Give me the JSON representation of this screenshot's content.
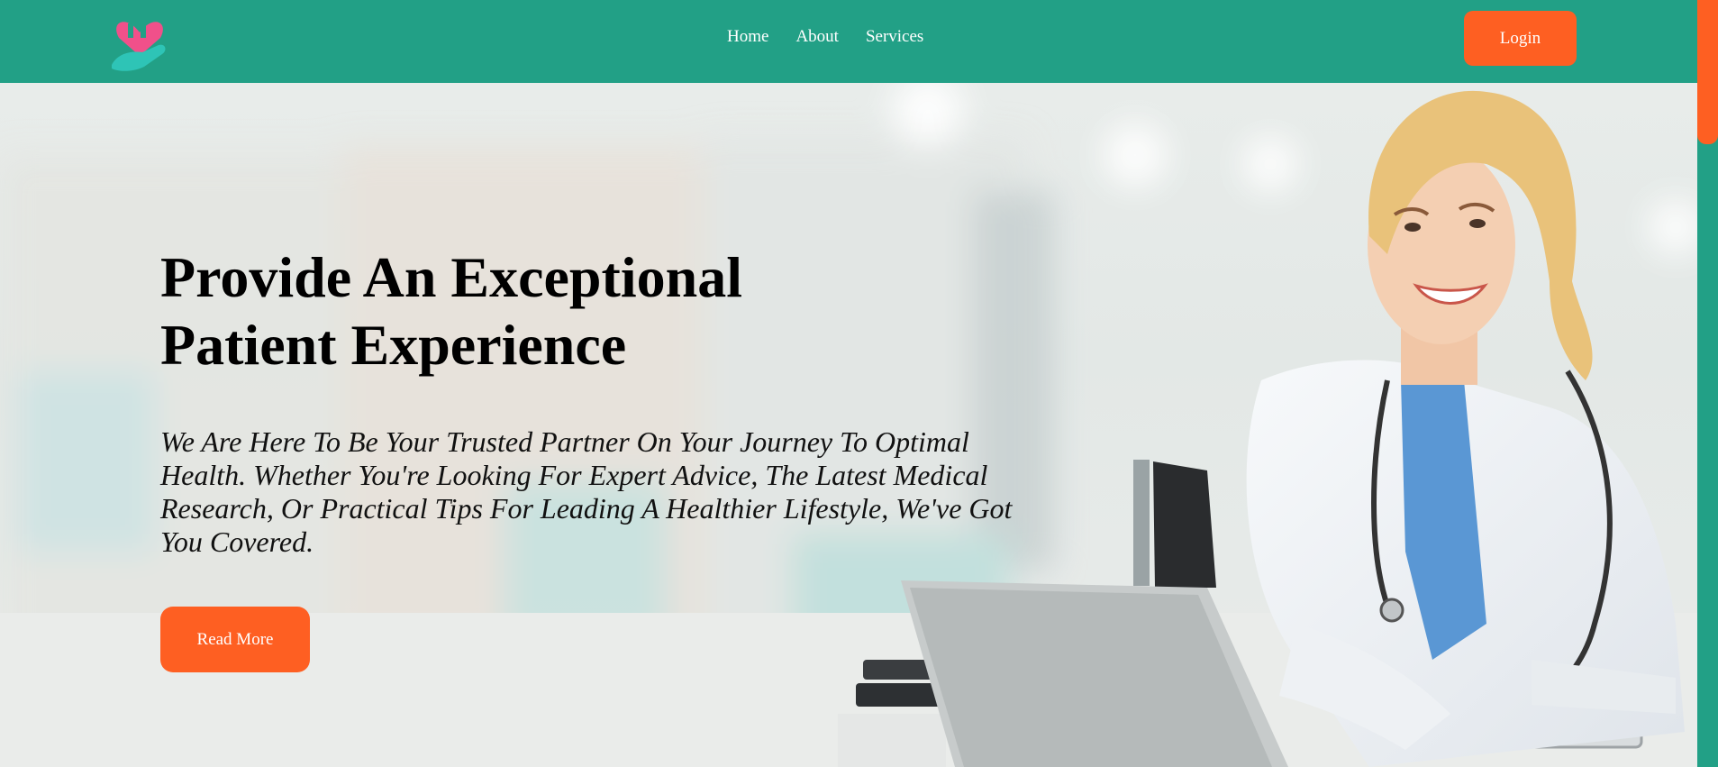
{
  "navbar": {
    "logo_icon": "heart-hand-logo",
    "links": [
      "Home",
      "About",
      "Services"
    ],
    "login_label": "Login"
  },
  "hero": {
    "title_line1": "Provide An Exceptional",
    "title_line2": "Patient Experience",
    "text": "We Are Here To Be Your Trusted Partner On Your Journey To Optimal Health. Whether You're Looking For Expert Advice, The Latest Medical Research, Or Practical Tips For Leading A Healthier Lifestyle, We've Got You Covered.",
    "button_label": "Read More",
    "image": "doctor-at-desk-photo"
  },
  "colors": {
    "brand": "#22a086",
    "accent": "#fe5f22"
  }
}
